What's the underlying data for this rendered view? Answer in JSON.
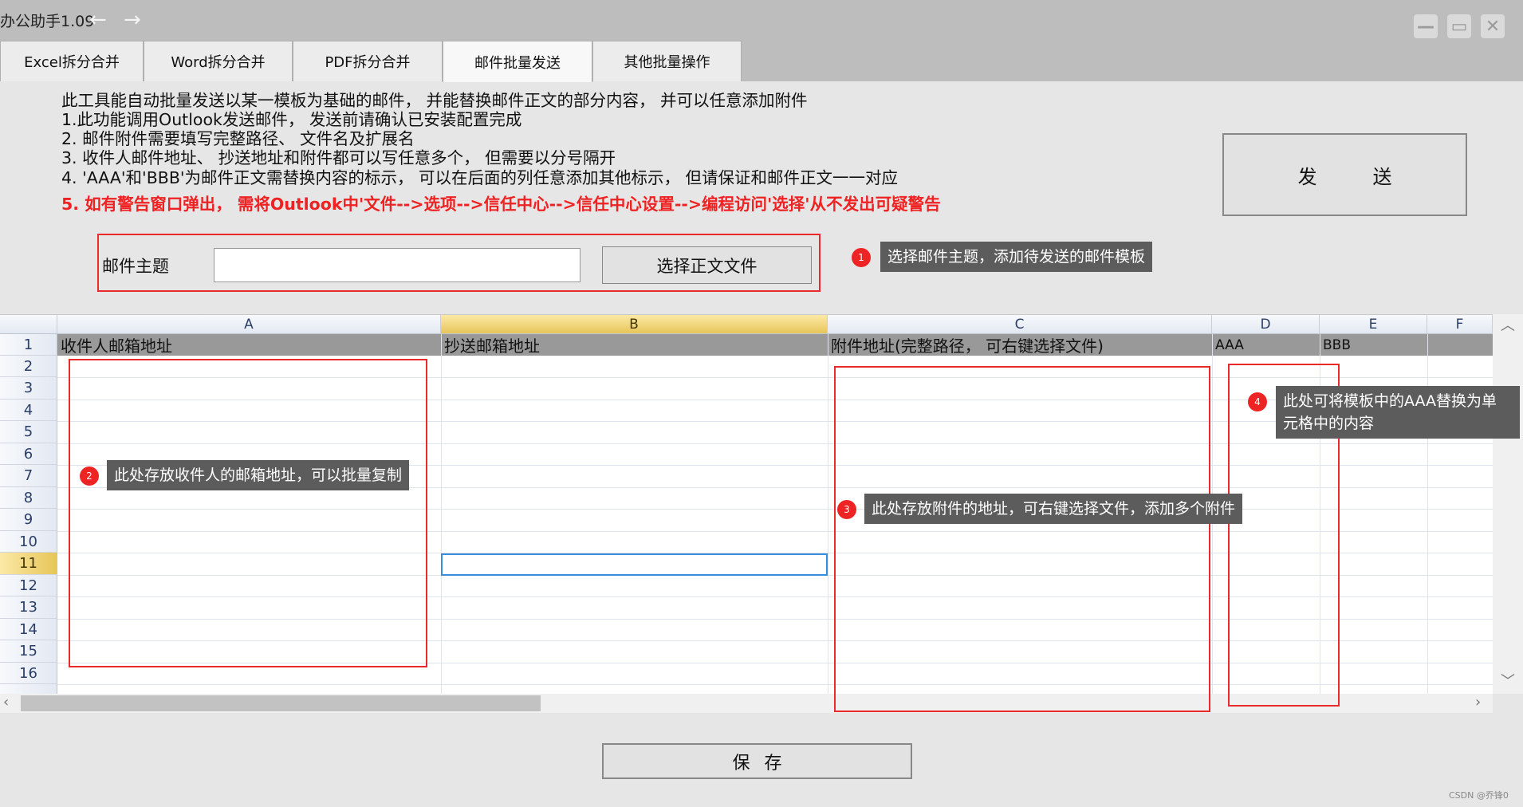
{
  "window": {
    "title": "办公助手1.09",
    "back_icon": "←",
    "forward_icon": "→"
  },
  "tabs": [
    {
      "label": "Excel拆分合并"
    },
    {
      "label": "Word拆分合并"
    },
    {
      "label": "PDF拆分合并"
    },
    {
      "label": "邮件批量发送",
      "active": true
    },
    {
      "label": "其他批量操作"
    }
  ],
  "instructions": [
    "此工具能自动批量发送以某一模板为基础的邮件， 并能替换邮件正文的部分内容， 并可以任意添加附件",
    "1.此功能调用Outlook发送邮件， 发送前请确认已安装配置完成",
    "2. 邮件附件需要填写完整路径、 文件名及扩展名",
    "3. 收件人邮件地址、 抄送地址和附件都可以写任意多个， 但需要以分号隔开",
    "4. 'AAA'和'BBB'为邮件正文需替换内容的标示， 可以在后面的列任意添加其他标示， 但请保证和邮件正文一一对应",
    "5. 如有警告窗口弹出， 需将Outlook中'文件-->选项-->信任中心-->信任中心设置-->编程访问'选择'从不发出可疑警告"
  ],
  "send_button": "发送",
  "subject": {
    "label": "邮件主题",
    "value": "",
    "choose_button": "选择正文文件"
  },
  "annotations": [
    {
      "num": "1",
      "text": "选择邮件主题，添加待发送的邮件模板"
    },
    {
      "num": "2",
      "text": "此处存放收件人的邮箱地址，可以批量复制"
    },
    {
      "num": "3",
      "text": "此处存放附件的地址，可右键选择文件，添加多个附件"
    },
    {
      "num": "4",
      "text_line1": "此处可将模板中的AAA替换为单",
      "text_line2": "元格中的内容"
    }
  ],
  "sheet": {
    "columns": [
      "A",
      "B",
      "C",
      "D",
      "E",
      "F"
    ],
    "active_column": "B",
    "rows": [
      "1",
      "2",
      "3",
      "4",
      "5",
      "6",
      "7",
      "8",
      "9",
      "10",
      "11",
      "12",
      "13",
      "14",
      "15",
      "16"
    ],
    "active_row": "11",
    "header_cells": [
      "收件人邮箱地址",
      "抄送邮箱地址",
      "附件地址(完整路径， 可右键选择文件)",
      "AAA",
      "BBB"
    ]
  },
  "save_button": "保存",
  "watermark": "CSDN @乔锋0",
  "colors": {
    "annotation_red": "#ee2424",
    "selection_blue": "#3a8ddb",
    "active_header": "#e7c559"
  }
}
